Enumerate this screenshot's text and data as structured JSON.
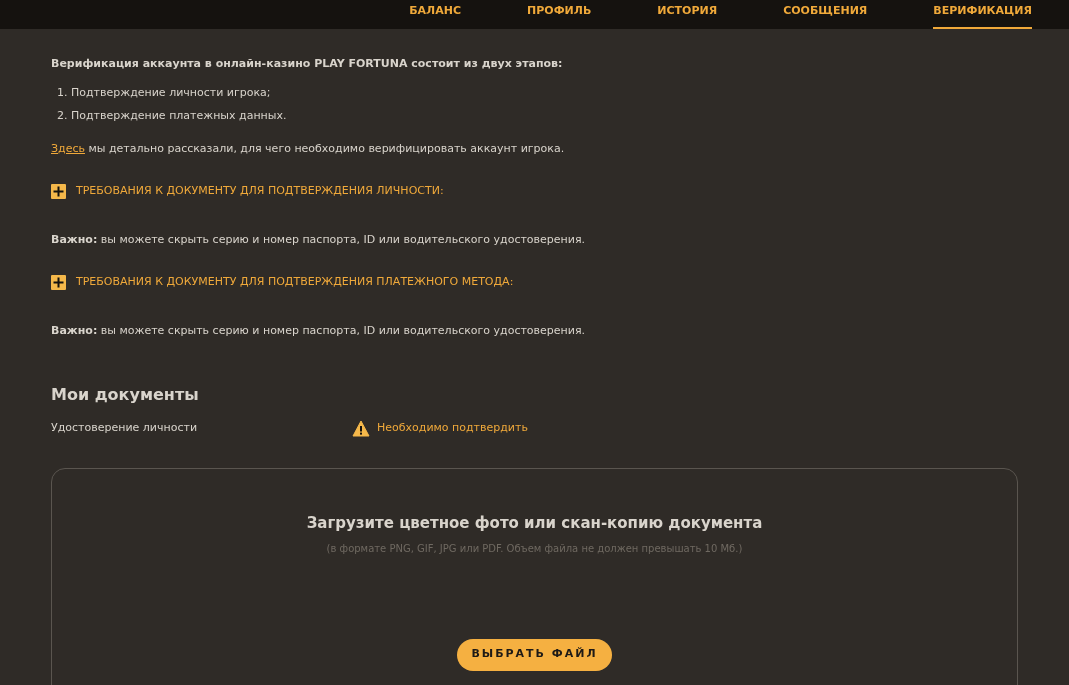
{
  "nav": [
    {
      "label": "БАЛАНС",
      "selected": false
    },
    {
      "label": "ПРОФИЛЬ",
      "selected": false
    },
    {
      "label": "ИСТОРИЯ",
      "selected": false
    },
    {
      "label": "СООБЩЕНИЯ",
      "selected": false
    },
    {
      "label": "ВЕРИФИКАЦИЯ",
      "selected": true
    }
  ],
  "intro": "Верификация аккаунта в онлайн-казино PLAY FORTUNA состоит из двух этапов:",
  "steps": [
    "1. Подтверждение личности игрока;",
    "2. Подтверждение платежных данных."
  ],
  "info": {
    "link": "Здесь",
    "text": "мы детально рассказали, для чего необходимо верифицировать аккаунт игрока."
  },
  "sections": [
    {
      "title": "ТРЕБОВАНИЯ К ДОКУМЕНТУ ДЛЯ ПОДТВЕРЖДЕНИЯ ЛИЧНОСТИ:",
      "expanded": false,
      "note": "**Важно:** вы можете скрыть серию и номер паспорта, ID или водительского удостоверения."
    },
    {
      "title": "ТРЕБОВАНИЯ К ДОКУМЕНТУ ДЛЯ ПОДТВЕРЖДЕНИЯ ПЛАТЕЖНОГО МЕТОДА:",
      "expanded": false,
      "note": "**Важно:** вы можете скрыть серию и номер паспорта, ID или водительского удостоверения."
    }
  ],
  "documents": {
    "title": "Мои документы",
    "rows": [
      {
        "name": "Удостоверение личности",
        "status": "Необходимо подтвердить",
        "kind": "warning"
      }
    ]
  },
  "upload": {
    "title": "Загрузите цветное фото или скан-копию документа",
    "hint": "(в формате PNG, GIF, JPG или PDF. Объем файла не должен превышать 10 Мб.)",
    "button": "ВЫБРАТЬ ФАЙЛ"
  }
}
